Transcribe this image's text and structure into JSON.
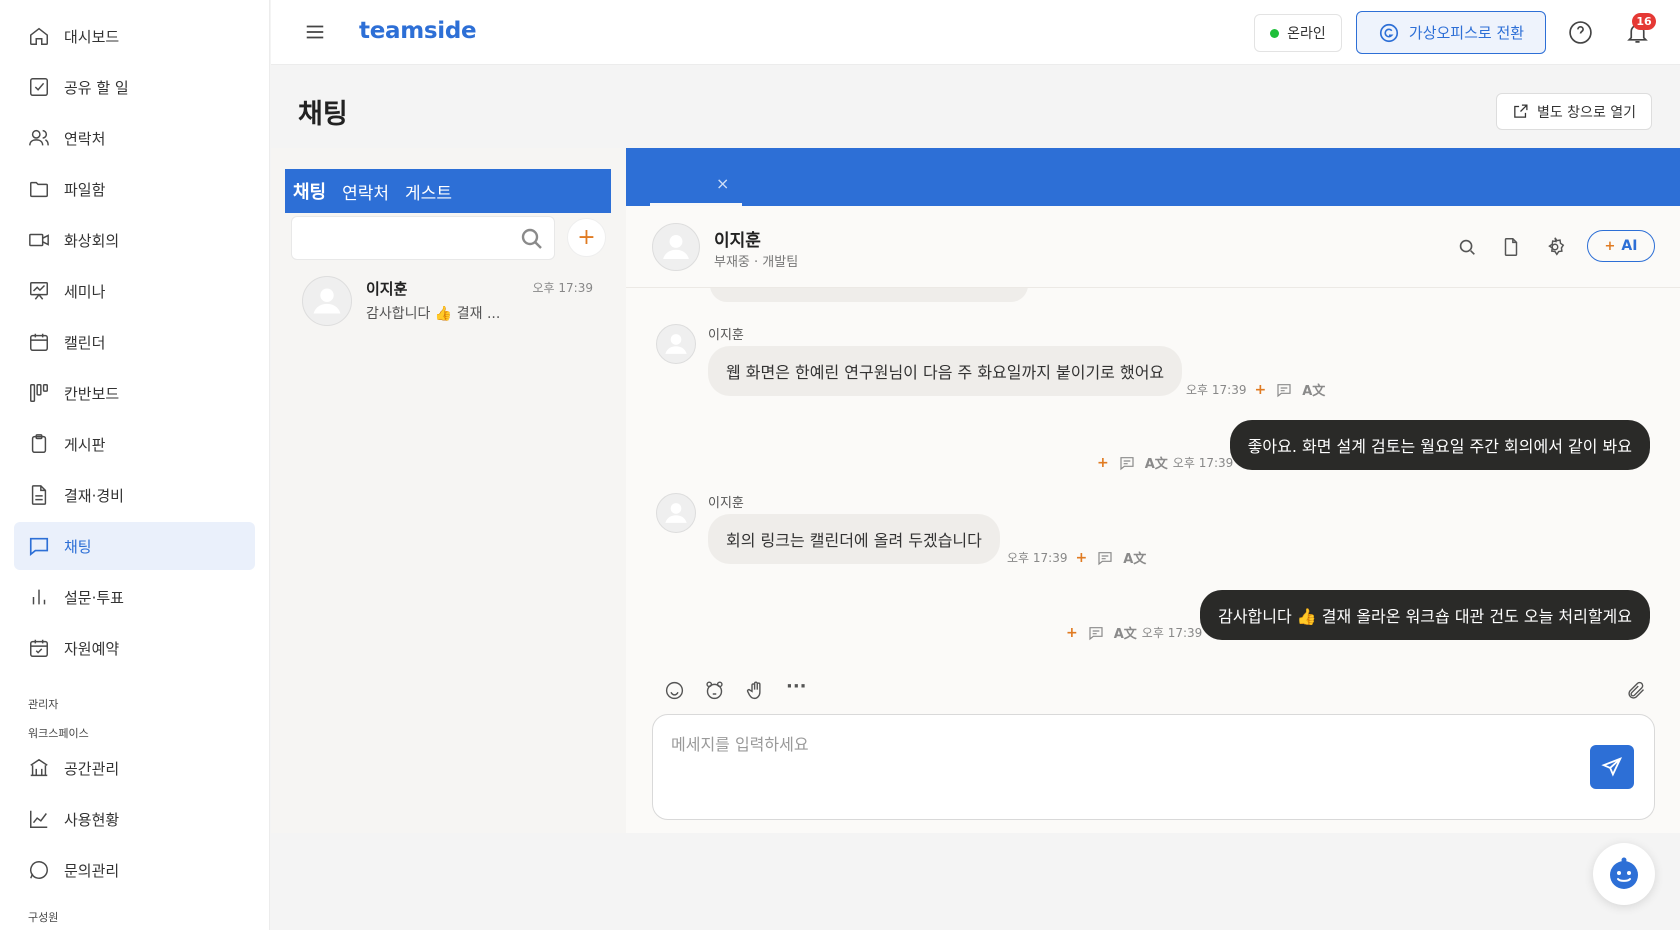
{
  "colors": {
    "accent": "#2d6fd6",
    "online": "#1fbf3a",
    "badge": "#e53935",
    "plus": "#e07b22"
  },
  "sidebar": {
    "items": [
      {
        "label": "대시보드",
        "icon": "home-icon"
      },
      {
        "label": "공유 할 일",
        "icon": "checkbox-icon"
      },
      {
        "label": "연락처",
        "icon": "users-icon"
      },
      {
        "label": "파일함",
        "icon": "folder-icon"
      },
      {
        "label": "화상회의",
        "icon": "video-icon"
      },
      {
        "label": "세미나",
        "icon": "presentation-icon"
      },
      {
        "label": "캘린더",
        "icon": "calendar-icon"
      },
      {
        "label": "칸반보드",
        "icon": "kanban-icon"
      },
      {
        "label": "게시판",
        "icon": "clipboard-icon"
      },
      {
        "label": "결재·경비",
        "icon": "document-icon"
      },
      {
        "label": "채팅",
        "icon": "chat-icon",
        "active": true
      },
      {
        "label": "설문·투표",
        "icon": "bar-chart-icon"
      },
      {
        "label": "자원예약",
        "icon": "calendar-check-icon"
      }
    ],
    "admin_label": "관리자",
    "workspace_label": "워크스페이스",
    "admin_items": [
      {
        "label": "공간관리",
        "icon": "building-icon"
      },
      {
        "label": "사용현황",
        "icon": "line-chart-icon"
      },
      {
        "label": "문의관리",
        "icon": "message-circle-icon"
      }
    ],
    "members_label": "구성원"
  },
  "header": {
    "logo": "teamside",
    "status": "온라인",
    "switch_label": "가상오피스로 전환",
    "notification_count": "16"
  },
  "page": {
    "title": "채팅",
    "open_window_label": "별도 창으로 열기"
  },
  "chat_list": {
    "tabs": [
      "채팅",
      "연락처",
      "게스트"
    ],
    "search_placeholder": "",
    "add_label": "+",
    "items": [
      {
        "name": "이지훈",
        "preview": "감사합니다 👍 결재 ...",
        "time": "오후 17:39"
      }
    ]
  },
  "conversation": {
    "tab_close": "×",
    "name": "이지훈",
    "subtitle": "부재중 · 개발팀",
    "ai_label": "AI",
    "ai_plus": "+",
    "translate_label": "A文",
    "messages": [
      {
        "sender": "이지훈",
        "text": "웹 화면은 한예린 연구원님이 다음 주 화요일까지 붙이기로 했어요",
        "time": "오후 17:39",
        "out": false
      },
      {
        "sender": "",
        "text": "좋아요. 화면 설계 검토는 월요일 주간 회의에서 같이 봐요",
        "time": "오후 17:39",
        "out": true
      },
      {
        "sender": "이지훈",
        "text": "회의 링크는 캘린더에 올려 두겠습니다",
        "time": "오후 17:39",
        "out": false
      },
      {
        "sender": "",
        "text": "감사합니다 👍 결재 올라온 워크숍 대관 건도 오늘 처리할게요",
        "time": "오후 17:39",
        "out": true
      }
    ],
    "composer_placeholder": "메세지를 입력하세요",
    "more_tools": "···"
  }
}
